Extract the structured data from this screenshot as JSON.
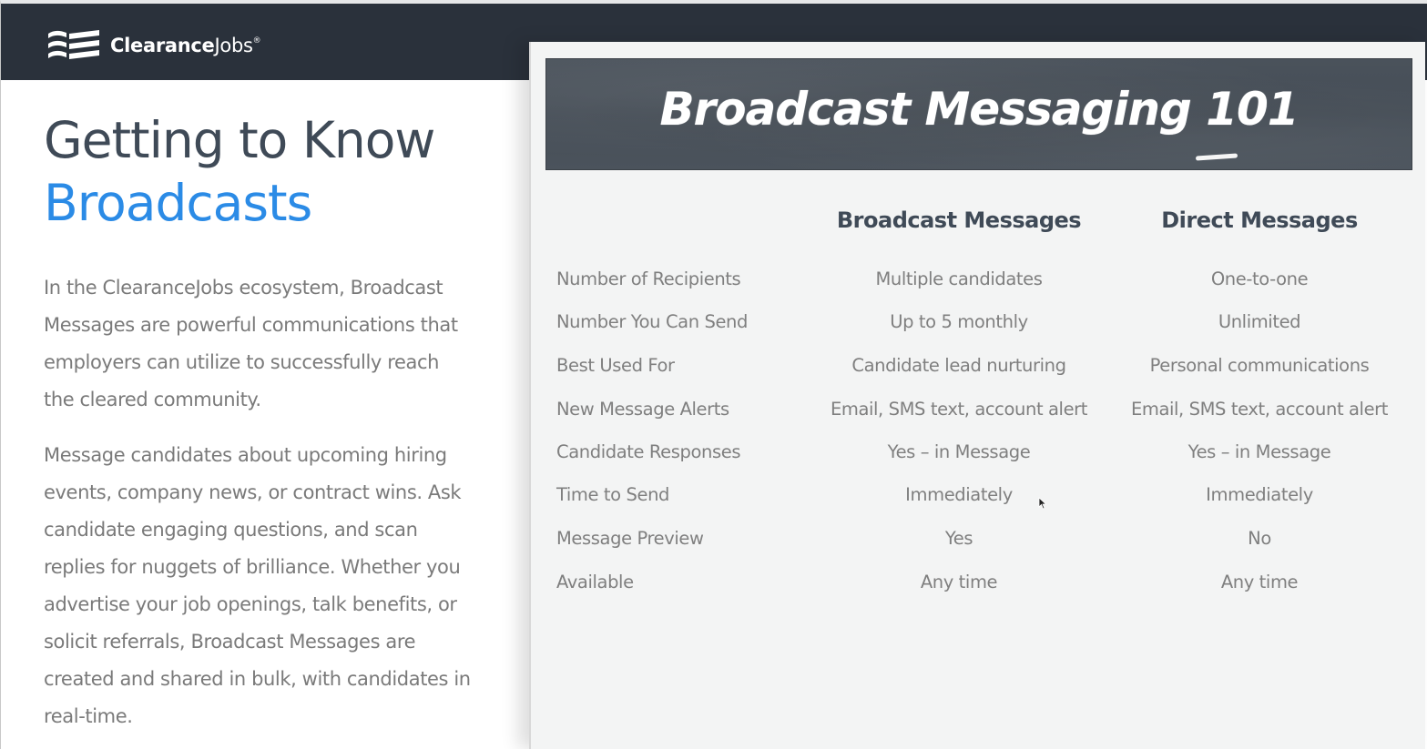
{
  "brand": {
    "logo_bold": "Clearance",
    "logo_regular": "Jobs",
    "logo_mark": "®"
  },
  "left": {
    "headline_line1": "Getting to Know",
    "headline_line2": "Broadcasts",
    "paragraph1": "In the ClearanceJobs ecosystem, Broadcast Messages are powerful communications that employers can utilize to successfully reach the cleared community.",
    "paragraph2": "Message candidates about upcoming hiring events, company news, or contract wins. Ask candidate engaging questions, and scan replies for nuggets of brilliance. Whether you advertise your job openings, talk benefits, or solicit referrals, Broadcast Messages are created and shared in bulk, with candidates in real-time."
  },
  "panel": {
    "banner_title": "Broadcast Messaging 101",
    "columns": [
      "Broadcast Messages",
      "Direct Messages"
    ],
    "rows": [
      {
        "label": "Number of Recipients",
        "broadcast": "Multiple candidates",
        "direct": "One-to-one"
      },
      {
        "label": "Number You Can Send",
        "broadcast": "Up to 5 monthly",
        "direct": "Unlimited"
      },
      {
        "label": "Best Used For",
        "broadcast": "Candidate lead nurturing",
        "direct": "Personal communications"
      },
      {
        "label": "New Message Alerts",
        "broadcast": "Email, SMS text, account alert",
        "direct": "Email, SMS text, account alert"
      },
      {
        "label": "Candidate Responses",
        "broadcast": "Yes – in Message",
        "direct": "Yes – in Message"
      },
      {
        "label": "Time to Send",
        "broadcast": "Immediately",
        "direct": "Immediately"
      },
      {
        "label": "Message Preview",
        "broadcast": "Yes",
        "direct": "No"
      },
      {
        "label": "Available",
        "broadcast": "Any time",
        "direct": "Any time"
      }
    ]
  },
  "colors": {
    "topbar": "#2a313b",
    "headline": "#3f4a57",
    "accent_blue": "#2b8be6",
    "body_text": "#7a7a7a",
    "panel_bg": "#f3f4f4"
  }
}
